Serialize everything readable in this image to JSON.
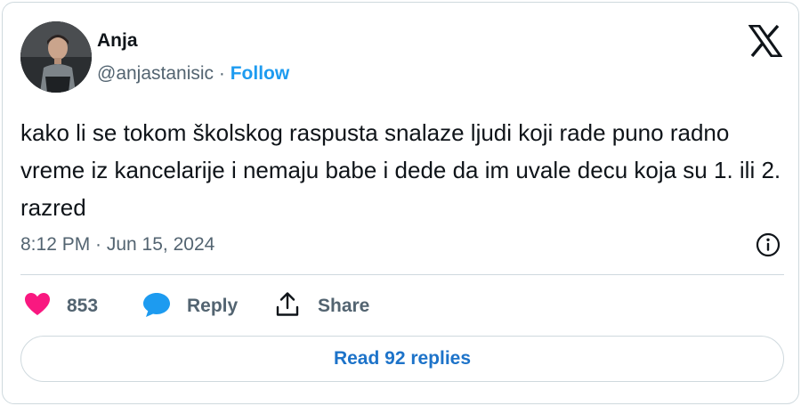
{
  "author": {
    "name": "Anja",
    "handle": "@anjastanisic",
    "separator": " · ",
    "follow_label": "Follow"
  },
  "tweet": {
    "text": "kako li se tokom školskog raspusta snalaze ljudi koji rade puno radno vreme iz kancelarije i nemaju babe i dede da im uvale decu koja su 1. ili 2. razred",
    "timestamp": "8:12 PM · Jun 15, 2024"
  },
  "actions": {
    "like_count": "853",
    "reply_label": "Reply",
    "share_label": "Share"
  },
  "read_replies_label": "Read 92 replies",
  "colors": {
    "accent": "#1d9bf0",
    "like": "#f91880",
    "reply_bubble": "#1d9bf0",
    "muted": "#536471",
    "border": "#cfd9de"
  },
  "icons": [
    "x-logo-icon",
    "heart-icon",
    "reply-bubble-icon",
    "share-icon",
    "info-icon"
  ]
}
